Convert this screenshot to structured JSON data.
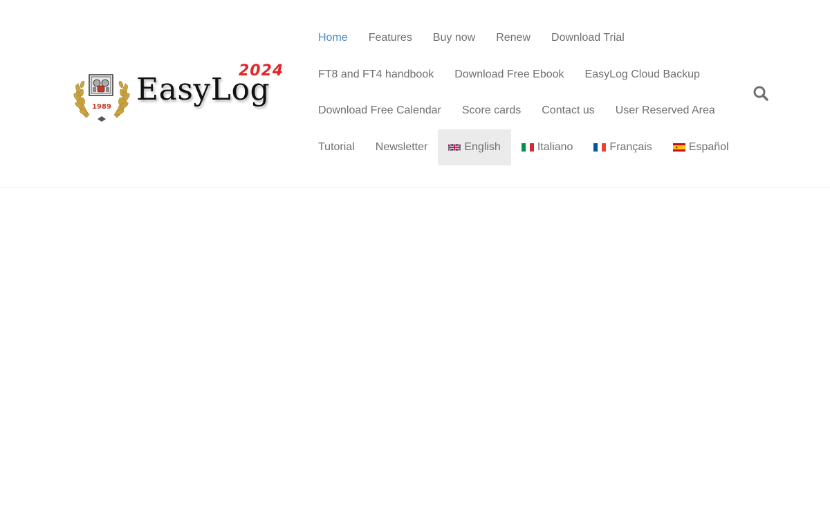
{
  "logo": {
    "brand": "EasyLog",
    "year_badge": "2024",
    "emblem_year": "1989"
  },
  "nav": {
    "rows": [
      [
        {
          "label": "Home",
          "state": "active"
        },
        {
          "label": "Features"
        },
        {
          "label": "Buy now"
        },
        {
          "label": "Renew"
        },
        {
          "label": "Download Trial"
        }
      ],
      [
        {
          "label": "FT8 and FT4 handbook"
        },
        {
          "label": "Download Free Ebook"
        },
        {
          "label": "EasyLog Cloud Backup"
        }
      ],
      [
        {
          "label": "Download Free Calendar"
        },
        {
          "label": "Score cards"
        },
        {
          "label": "Contact us"
        },
        {
          "label": "User Reserved Area"
        }
      ],
      [
        {
          "label": "Tutorial"
        },
        {
          "label": "Newsletter"
        },
        {
          "label": "English",
          "icon": "uk-flag-icon",
          "state": "current-language"
        },
        {
          "label": "Italiano",
          "icon": "italy-flag-icon"
        },
        {
          "label": "Français",
          "icon": "france-flag-icon"
        },
        {
          "label": "Español",
          "icon": "spain-flag-icon"
        }
      ]
    ]
  },
  "search": {
    "icon": "search-icon"
  },
  "colors": {
    "active_link": "#4b89c3",
    "link": "#6f6f6f",
    "highlight_bg": "#ebebeb",
    "year_badge": "#e2272b"
  }
}
